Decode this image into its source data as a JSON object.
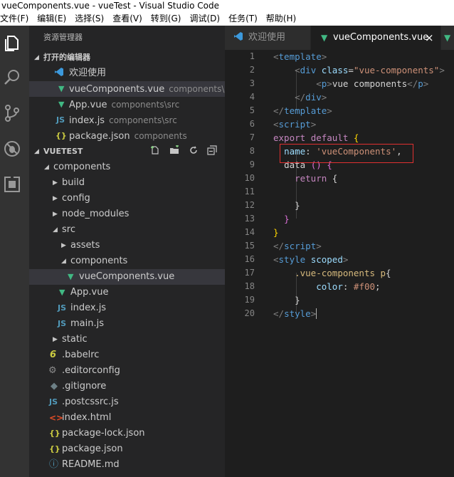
{
  "window": {
    "title": "vueComponents.vue - vueTest - Visual Studio Code"
  },
  "menu": [
    "文件(F)",
    "编辑(E)",
    "选择(S)",
    "查看(V)",
    "转到(G)",
    "调试(D)",
    "任务(T)",
    "帮助(H)"
  ],
  "activity": [
    "files-icon",
    "search-icon",
    "source-control-icon",
    "debug-icon",
    "extensions-icon"
  ],
  "sidebar": {
    "title": "资源管理器",
    "open_editors": {
      "label": "打开的编辑器",
      "items": [
        {
          "icon": "vscode",
          "name": "欢迎使用",
          "desc": ""
        },
        {
          "icon": "vue",
          "name": "vueComponents.vue",
          "desc": "components\\src\\..."
        },
        {
          "icon": "vue",
          "name": "App.vue",
          "desc": "components\\src"
        },
        {
          "icon": "js",
          "name": "index.js",
          "desc": "components\\src"
        },
        {
          "icon": "json",
          "name": "package.json",
          "desc": "components"
        }
      ]
    },
    "workspace": {
      "label": "VUETEST",
      "tree": [
        {
          "name": "components",
          "twisty": "open",
          "icon": ""
        },
        {
          "name": "build",
          "twisty": "closed",
          "icon": ""
        },
        {
          "name": "config",
          "twisty": "closed",
          "icon": ""
        },
        {
          "name": "node_modules",
          "twisty": "closed",
          "icon": ""
        },
        {
          "name": "src",
          "twisty": "open",
          "icon": ""
        },
        {
          "name": "assets",
          "twisty": "closed",
          "icon": ""
        },
        {
          "name": "components",
          "twisty": "open",
          "icon": ""
        },
        {
          "name": "vueComponents.vue",
          "twisty": "",
          "icon": "vue"
        },
        {
          "name": "App.vue",
          "twisty": "",
          "icon": "vue"
        },
        {
          "name": "index.js",
          "twisty": "",
          "icon": "js"
        },
        {
          "name": "main.js",
          "twisty": "",
          "icon": "js"
        },
        {
          "name": "static",
          "twisty": "closed",
          "icon": ""
        },
        {
          "name": ".babelrc",
          "twisty": "",
          "icon": "babel"
        },
        {
          "name": ".editorconfig",
          "twisty": "",
          "icon": "gear"
        },
        {
          "name": ".gitignore",
          "twisty": "",
          "icon": "git"
        },
        {
          "name": ".postcssrc.js",
          "twisty": "",
          "icon": "js"
        },
        {
          "name": "index.html",
          "twisty": "",
          "icon": "html"
        },
        {
          "name": "package-lock.json",
          "twisty": "",
          "icon": "json"
        },
        {
          "name": "package.json",
          "twisty": "",
          "icon": "json"
        },
        {
          "name": "README.md",
          "twisty": "",
          "icon": "info"
        }
      ]
    }
  },
  "tabs": [
    {
      "label": "欢迎使用",
      "icon": "vscode",
      "active": false
    },
    {
      "label": "vueComponents.vue",
      "icon": "vue",
      "active": true,
      "close": "×"
    }
  ],
  "editor": {
    "line_numbers": [
      "1",
      "2",
      "3",
      "4",
      "5",
      "6",
      "7",
      "8",
      "9",
      "10",
      "11",
      "12",
      "13",
      "14",
      "15",
      "16",
      "17",
      "18",
      "19",
      "20"
    ]
  },
  "colors": {
    "vue": "#41b883",
    "js": "#519aba",
    "json": "#cbcb41",
    "html": "#e44d26",
    "highlight": "#e03030"
  }
}
